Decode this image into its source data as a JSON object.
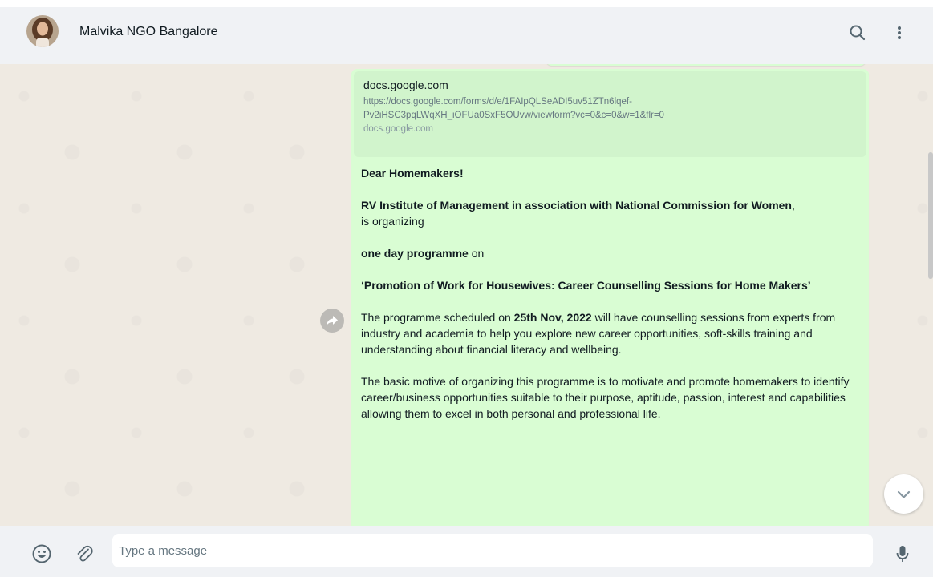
{
  "header": {
    "contact_name": "Malvika NGO Bangalore"
  },
  "link_preview": {
    "title": "docs.google.com",
    "url_line1": "https://docs.google.com/forms/d/e/1FAIpQLSeADI5uv51ZTn6lqef-",
    "url_line2": "Pv2iHSC3pqLWqXH_iOFUa0SxF5OUvw/viewform?vc=0&c=0&w=1&flr=0",
    "domain": "docs.google.com"
  },
  "message": {
    "greeting": "Dear Homemakers!",
    "organizer": "RV Institute of Management in association with National Commission for Women",
    "organizer_suffix": ",",
    "organizing": "is organizing",
    "programme_bold": "one day programme",
    "programme_suffix": " on",
    "topic": "‘Promotion of Work for Housewives: Career Counselling Sessions for Home Makers’",
    "schedule_pre": "The programme scheduled on ",
    "schedule_date": "25th Nov, 2022",
    "schedule_post": " will have counselling sessions from experts from industry and academia to help you explore new career opportunities, soft-skills training and understanding about financial literacy and wellbeing.",
    "motive": "The basic motive of organizing this programme is to motivate and promote homemakers to identify career/business opportunities suitable to their purpose, aptitude, passion, interest and capabilities allowing them to excel in both personal and professional life."
  },
  "composer": {
    "placeholder": "Type a message"
  },
  "icons": {
    "search": "search-icon",
    "menu": "menu-dots-icon",
    "forward": "forward-icon",
    "scroll_down": "chevron-down-icon",
    "emoji": "emoji-icon",
    "attach": "attach-icon",
    "mic": "mic-icon"
  },
  "colors": {
    "header_bg": "#f0f2f5",
    "chat_bg": "#efeae2",
    "bubble_bg": "#d9fdd3",
    "preview_bg": "#d1f4cc",
    "text": "#111b21",
    "icon": "#54656f"
  }
}
